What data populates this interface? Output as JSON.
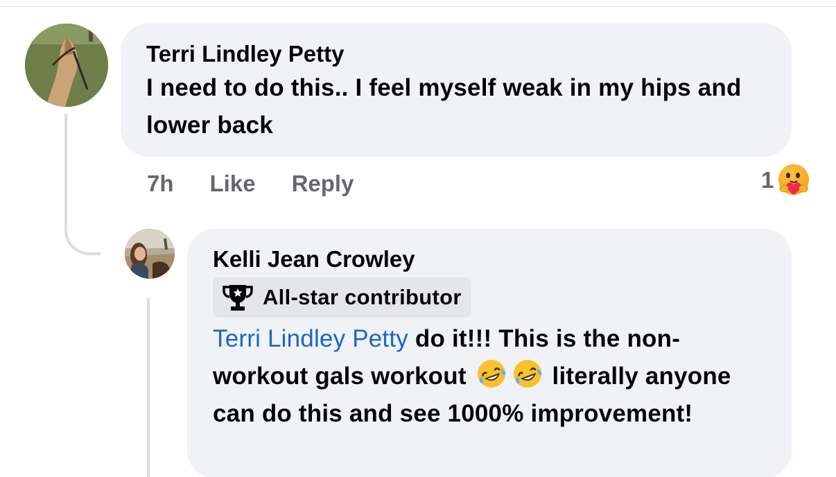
{
  "comments": [
    {
      "author": "Terri Lindley Petty",
      "text": "I need to do this.. I feel myself weak in my hips and lower back",
      "time": "7h",
      "like_label": "Like",
      "reply_label": "Reply",
      "reaction_count": "1",
      "reaction_icon": "care-reaction-icon"
    },
    {
      "author": "Kelli Jean Crowley",
      "badge": {
        "icon": "trophy-icon",
        "label": "All-star contributor"
      },
      "mention": "Terri Lindley Petty",
      "text_part1": " do it!!! This is the non-workout gals workout ",
      "emojis": [
        "rolling-laughing-emoji",
        "rolling-laughing-emoji"
      ],
      "text_part2": " literally anyone can do this and see 1000% improvement!"
    }
  ],
  "colors": {
    "bubble": "#f0f2f5",
    "badge": "#e4e6eb",
    "mention": "#1d66c5",
    "meta_text": "#65676b",
    "thread_line": "#dadde1"
  }
}
